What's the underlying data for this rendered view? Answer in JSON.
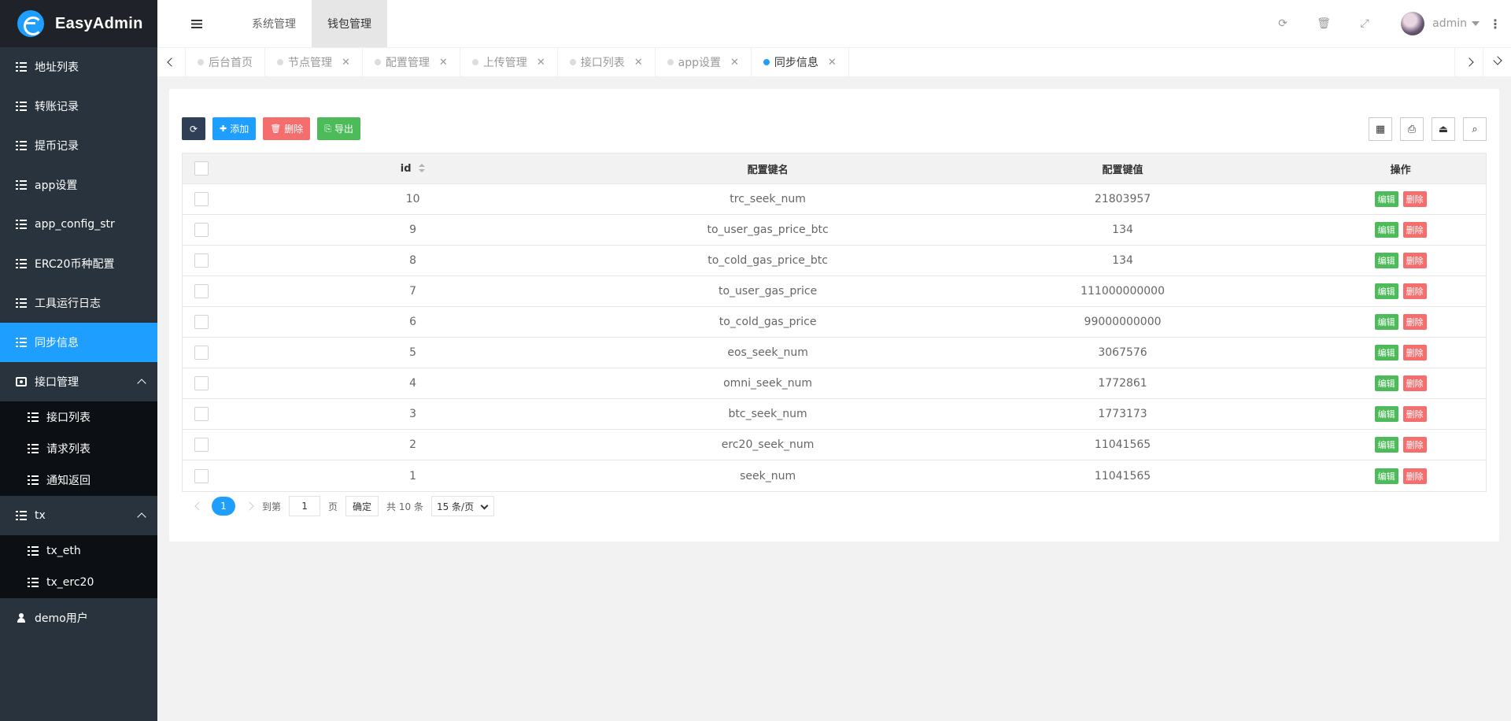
{
  "app": {
    "title": "EasyAdmin"
  },
  "sidebar": {
    "items": [
      {
        "label": "地址列表"
      },
      {
        "label": "转账记录"
      },
      {
        "label": "提币记录"
      },
      {
        "label": "app设置"
      },
      {
        "label": "app_config_str"
      },
      {
        "label": "ERC20币种配置"
      },
      {
        "label": "工具运行日志"
      },
      {
        "label": "同步信息",
        "active": true
      }
    ],
    "group_api": {
      "label": "接口管理",
      "children": [
        "接口列表",
        "请求列表",
        "通知返回"
      ]
    },
    "group_tx": {
      "label": "tx",
      "children": [
        "tx_eth",
        "tx_erc20"
      ]
    },
    "demo_user": {
      "label": "demo用户"
    }
  },
  "header": {
    "nav": [
      "系统管理",
      "钱包管理"
    ],
    "active_nav": "钱包管理",
    "user": "admin",
    "more": "⋮"
  },
  "tabs": [
    {
      "label": "后台首页",
      "closable": false
    },
    {
      "label": "节点管理",
      "closable": true
    },
    {
      "label": "配置管理",
      "closable": true
    },
    {
      "label": "上传管理",
      "closable": true
    },
    {
      "label": "接口列表",
      "closable": true
    },
    {
      "label": "app设置",
      "closable": true
    },
    {
      "label": "同步信息",
      "closable": true,
      "active": true
    }
  ],
  "toolbar": {
    "add_label": "添加",
    "delete_label": "删除",
    "export_label": "导出"
  },
  "table": {
    "headers": {
      "id": "id",
      "key": "配置键名",
      "value": "配置键值",
      "actions": "操作"
    },
    "rows": [
      {
        "id": "10",
        "key": "trc_seek_num",
        "value": "21803957"
      },
      {
        "id": "9",
        "key": "to_user_gas_price_btc",
        "value": "134"
      },
      {
        "id": "8",
        "key": "to_cold_gas_price_btc",
        "value": "134"
      },
      {
        "id": "7",
        "key": "to_user_gas_price",
        "value": "111000000000"
      },
      {
        "id": "6",
        "key": "to_cold_gas_price",
        "value": "99000000000"
      },
      {
        "id": "5",
        "key": "eos_seek_num",
        "value": "3067576"
      },
      {
        "id": "4",
        "key": "omni_seek_num",
        "value": "1772861"
      },
      {
        "id": "3",
        "key": "btc_seek_num",
        "value": "1773173"
      },
      {
        "id": "2",
        "key": "erc20_seek_num",
        "value": "11041565"
      },
      {
        "id": "1",
        "key": "seek_num",
        "value": "11041565"
      }
    ],
    "edit_label": "编辑",
    "delete_label": "删除"
  },
  "pager": {
    "current": "1",
    "goto_label": "到第",
    "goto_value": "1",
    "page_unit": "页",
    "confirm_label": "确定",
    "total_text": "共 10 条",
    "page_size": "15 条/页"
  },
  "colors": {
    "accent": "#1e9fff",
    "sidebar": "#28333e",
    "danger": "#f46e6e",
    "success": "#4ebb5b"
  }
}
